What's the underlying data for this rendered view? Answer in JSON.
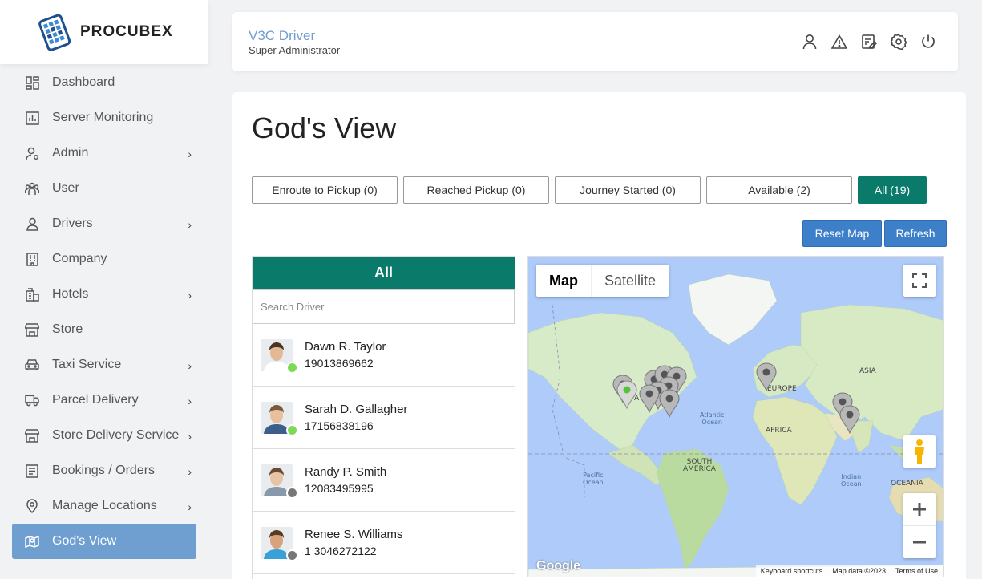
{
  "brand": {
    "name": "PROCUBEX"
  },
  "sidebar": {
    "items": [
      {
        "label": "Dashboard",
        "icon": "dashboard-icon",
        "has_children": false
      },
      {
        "label": "Server Monitoring",
        "icon": "chart-icon",
        "has_children": false
      },
      {
        "label": "Admin",
        "icon": "admin-icon",
        "has_children": true
      },
      {
        "label": "User",
        "icon": "users-icon",
        "has_children": false
      },
      {
        "label": "Drivers",
        "icon": "driver-icon",
        "has_children": true
      },
      {
        "label": "Company",
        "icon": "building-icon",
        "has_children": false
      },
      {
        "label": "Hotels",
        "icon": "hotel-icon",
        "has_children": true
      },
      {
        "label": "Store",
        "icon": "store-icon",
        "has_children": false
      },
      {
        "label": "Taxi Service",
        "icon": "car-icon",
        "has_children": true
      },
      {
        "label": "Parcel Delivery",
        "icon": "truck-icon",
        "has_children": true
      },
      {
        "label": "Store Delivery Service",
        "icon": "store-icon",
        "has_children": true
      },
      {
        "label": "Bookings / Orders",
        "icon": "list-icon",
        "has_children": true
      },
      {
        "label": "Manage Locations",
        "icon": "location-icon",
        "has_children": true
      },
      {
        "label": "God's View",
        "icon": "map-icon",
        "has_children": false,
        "active": true
      }
    ],
    "chevron": "›"
  },
  "header": {
    "title": "V3C Driver",
    "subtitle": "Super Administrator",
    "icons": [
      "user-icon",
      "alert-icon",
      "edit-icon",
      "settings-icon",
      "power-icon"
    ]
  },
  "main": {
    "title": "God's View",
    "filters": [
      {
        "label": "Enroute to Pickup  (0)"
      },
      {
        "label": "Reached Pickup  (0)"
      },
      {
        "label": "Journey Started  (0)"
      },
      {
        "label": "Available  (2)"
      },
      {
        "label": "All  (19)",
        "active": true
      }
    ],
    "actions": {
      "reset": "Reset Map",
      "refresh": "Refresh"
    },
    "panel": {
      "heading": "All",
      "search_placeholder": "Search Driver",
      "drivers": [
        {
          "name": "Dawn R. Taylor",
          "phone": "19013869662",
          "status": "online",
          "status_color": "#7ed957",
          "skin": "#e2b895",
          "hair": "#4a3322",
          "shirt": "#ffffff"
        },
        {
          "name": "Sarah D. Gallagher",
          "phone": "17156838196",
          "status": "online",
          "status_color": "#7ed957",
          "skin": "#e8c09e",
          "hair": "#7a5a3a",
          "shirt": "#3b5f8a"
        },
        {
          "name": "Randy P. Smith",
          "phone": "12083495995",
          "status": "offline",
          "status_color": "#777777",
          "skin": "#e8c4a6",
          "hair": "#6b4a30",
          "shirt": "#8899aa"
        },
        {
          "name": "Renee S. Williams",
          "phone": "1 3046272122",
          "status": "offline",
          "status_color": "#777777",
          "skin": "#d8a27a",
          "hair": "#5a3b22",
          "shirt": "#3aa0d8"
        }
      ]
    },
    "map": {
      "type_map": "Map",
      "type_satellite": "Satellite",
      "google": "Google",
      "footer": [
        "Keyboard shortcuts",
        "Map data ©2023",
        "Terms of Use"
      ],
      "labels": {
        "europe": "EUROPE",
        "asia": "ASIA",
        "africa": "AFRICA",
        "south_america": "SOUTH\nAMERICA",
        "oceania": "OCEANIA",
        "na_fragment": "A",
        "atlantic": "Atlantic\nOcean",
        "pacific": "Pacific\nOcean",
        "indian": "Indian\nOcean"
      }
    }
  }
}
